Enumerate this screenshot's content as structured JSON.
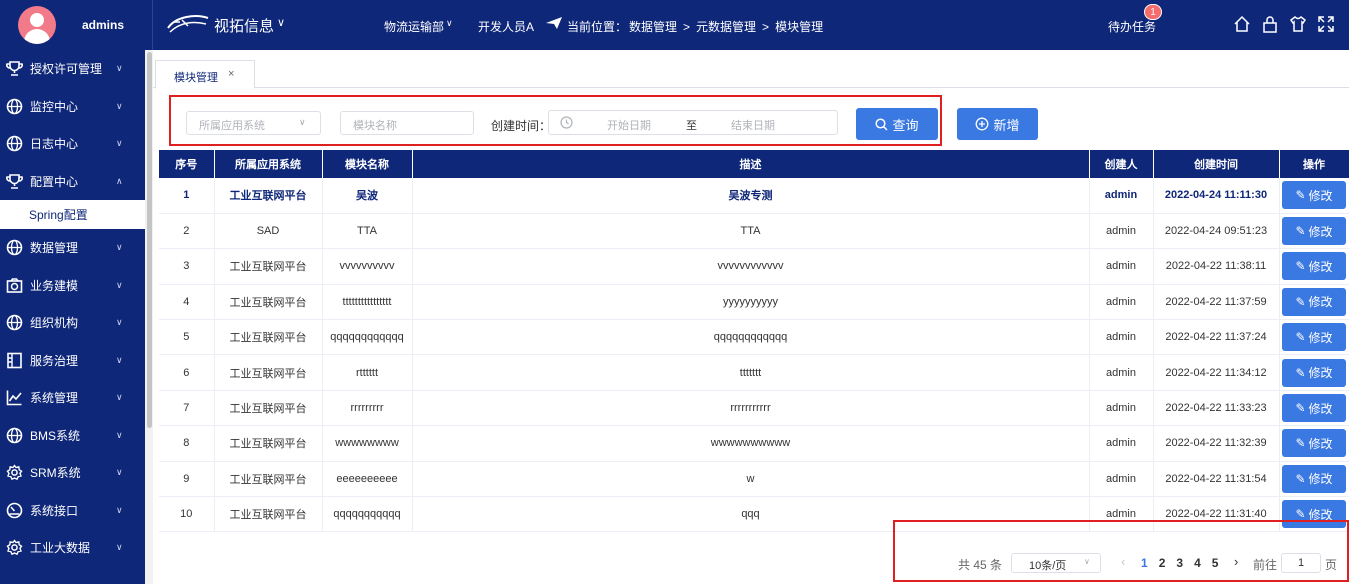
{
  "header": {
    "username": "admins",
    "app_title": "视拓信息",
    "dept": "物流运输部",
    "role": "开发人员A",
    "location_label": "当前位置：",
    "breadcrumb": [
      "数据管理",
      "元数据管理",
      "模块管理"
    ],
    "todo_label": "待办任务",
    "todo_count": "1",
    "icons": [
      "home-icon",
      "lock-icon",
      "tshirt-icon",
      "fullscreen-icon"
    ]
  },
  "sidebar": {
    "items": [
      {
        "label": "授权许可管理",
        "icon": "trophy-icon",
        "expanded": false
      },
      {
        "label": "监控中心",
        "icon": "globe-icon",
        "expanded": false
      },
      {
        "label": "日志中心",
        "icon": "globe-icon",
        "expanded": false
      },
      {
        "label": "配置中心",
        "icon": "trophy-icon",
        "expanded": true
      },
      {
        "label": "数据管理",
        "icon": "globe-icon",
        "expanded": false
      },
      {
        "label": "业务建模",
        "icon": "camera-icon",
        "expanded": false
      },
      {
        "label": "组织机构",
        "icon": "globe-icon",
        "expanded": false
      },
      {
        "label": "服务治理",
        "icon": "panel-icon",
        "expanded": false
      },
      {
        "label": "系统管理",
        "icon": "chart-icon",
        "expanded": false
      },
      {
        "label": "BMS系统",
        "icon": "globe-icon",
        "expanded": false
      },
      {
        "label": "SRM系统",
        "icon": "gear-icon",
        "expanded": false
      },
      {
        "label": "系统接口",
        "icon": "speedometer-icon",
        "expanded": false
      },
      {
        "label": "工业大数据",
        "icon": "gear-icon",
        "expanded": false
      }
    ],
    "sub_item": "Spring配置"
  },
  "tab": {
    "label": "模块管理",
    "close": "×"
  },
  "filter": {
    "app_placeholder": "所属应用系统",
    "name_placeholder": "模块名称",
    "created_label": "创建时间：",
    "start_placeholder": "开始日期",
    "range_sep": "至",
    "end_placeholder": "结束日期",
    "search_label": "查询",
    "add_label": "新增"
  },
  "table": {
    "columns": [
      "序号",
      "所属应用系统",
      "模块名称",
      "描述",
      "创建人",
      "创建时间",
      "操作"
    ],
    "edit_label": "修改",
    "rows": [
      {
        "no": "1",
        "app": "工业互联网平台",
        "name": "吴波",
        "desc": "吴波专测",
        "creator": "admin",
        "time": "2022-04-24 11:11:30"
      },
      {
        "no": "2",
        "app": "SAD",
        "name": "TTA",
        "desc": "TTA",
        "creator": "admin",
        "time": "2022-04-24 09:51:23"
      },
      {
        "no": "3",
        "app": "工业互联网平台",
        "name": "vvvvvvvvvv",
        "desc": "vvvvvvvvvvvv",
        "creator": "admin",
        "time": "2022-04-22 11:38:11"
      },
      {
        "no": "4",
        "app": "工业互联网平台",
        "name": "tttttttttttttttt",
        "desc": "yyyyyyyyyy",
        "creator": "admin",
        "time": "2022-04-22 11:37:59"
      },
      {
        "no": "5",
        "app": "工业互联网平台",
        "name": "qqqqqqqqqqqq",
        "desc": "qqqqqqqqqqqq",
        "creator": "admin",
        "time": "2022-04-22 11:37:24"
      },
      {
        "no": "6",
        "app": "工业互联网平台",
        "name": "rtttttt",
        "desc": "ttttttt",
        "creator": "admin",
        "time": "2022-04-22 11:34:12"
      },
      {
        "no": "7",
        "app": "工业互联网平台",
        "name": "rrrrrrrrr",
        "desc": "rrrrrrrrrrr",
        "creator": "admin",
        "time": "2022-04-22 11:33:23"
      },
      {
        "no": "8",
        "app": "工业互联网平台",
        "name": "wwwwwwww",
        "desc": "wwwwwwwwww",
        "creator": "admin",
        "time": "2022-04-22 11:32:39"
      },
      {
        "no": "9",
        "app": "工业互联网平台",
        "name": "eeeeeeeeee",
        "desc": "w",
        "creator": "admin",
        "time": "2022-04-22 11:31:54"
      },
      {
        "no": "10",
        "app": "工业互联网平台",
        "name": "qqqqqqqqqqq",
        "desc": "qqq",
        "creator": "admin",
        "time": "2022-04-22 11:31:40"
      }
    ]
  },
  "pagination": {
    "total": "共 45 条",
    "page_size": "10条/页",
    "pages": [
      "1",
      "2",
      "3",
      "4",
      "5"
    ],
    "current": "1",
    "goto_label": "前往",
    "goto_value": "1",
    "unit": "页"
  },
  "colors": {
    "primary": "#0f2779",
    "accent": "#3a78e2",
    "highlight": "#e02020"
  }
}
